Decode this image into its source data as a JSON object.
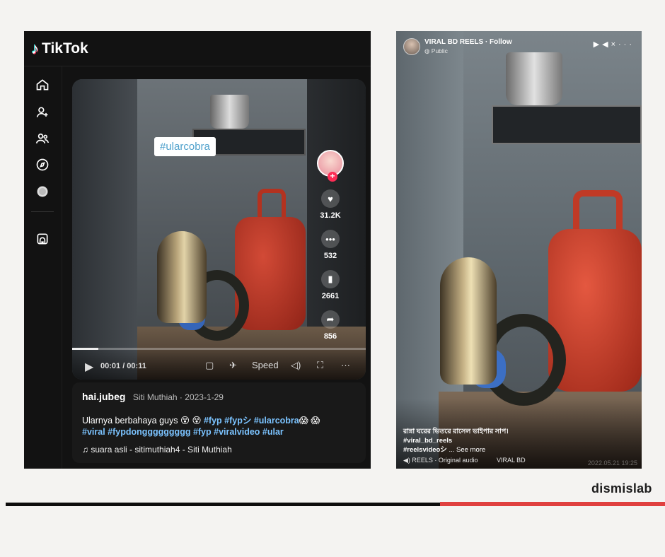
{
  "tiktok": {
    "brand": "TikTok",
    "nav_icons": [
      "home-icon",
      "following-icon",
      "friends-icon",
      "explore-icon",
      "live-icon",
      "profile-icon"
    ],
    "hashtag_sticker": "#ularcobra",
    "actions": {
      "likes": "31.2K",
      "comments": "532",
      "saves": "2661",
      "shares": "856"
    },
    "player": {
      "time": "00:01 / 00:11",
      "speed_label": "Speed",
      "progress_fraction": 0.09
    },
    "caption": {
      "username": "hai.jubeg",
      "meta": "Siti Muthiah · 2023-1-29",
      "text_start": "Ularnya berbahaya guys 😵 😵 ",
      "hashtags_line1": "#fyp #fypシ #ularcobra",
      "emoji_end": "😱 😱",
      "hashtags_line2": "#viral #fypdonggggggggg #fyp #viralvideo #ular",
      "sound": "suara asli - sitimuthiah4 - Siti Muthiah"
    }
  },
  "facebook": {
    "page_name": "VIRAL BD REELS · Follow",
    "visibility": "Public",
    "caption_line1": "রান্না ঘরের ভিতরে রাসেল ভাইপার সাপ।",
    "hashtag1": "#viral_bd_reels",
    "hashtag2": "#reelsvideoシ",
    "see_more": "... See more",
    "audio_source": "REELS · Original audio",
    "audio_author": "VIRAL BD",
    "watermark_date": "2022.05.21 19:25"
  },
  "footer": {
    "brand": "dismislab"
  },
  "colors": {
    "accent_red": "#e0403f",
    "tiktok_bg": "#121212",
    "hashtag_blue": "#7bc3ff"
  }
}
